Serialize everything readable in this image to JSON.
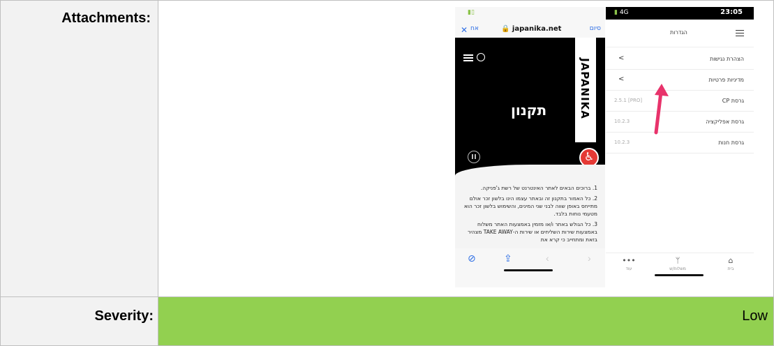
{
  "table": {
    "attachments_label": "Attachments:",
    "severity_label": "Severity:",
    "severity_value": "Low"
  },
  "colors": {
    "severity_low_bg": "#92d050",
    "label_cell_bg": "#f2f2f2",
    "border": "#bfbfbf"
  },
  "browser_shot": {
    "close": "✕",
    "back": "אח",
    "url": "🔒 japanika.net",
    "done": "סיום",
    "logo": "JAPANIKA",
    "title": "תקנון",
    "paragraphs": [
      "1. ברוכים הבאים לאתר האינטרנט של רשת ג'פניקה.",
      "2. כל האמור בתקנון זה ובאתר עצמו הינו בלשון זכר אולם מתייחס באופן שווה לבני שני המינים, והשימוש בלשון זכר הוא מטעמי נוחות בלבד.",
      "3. כל הגולש באתר ו/או מזמין באמצעות האתר משלוח באמצעות שירות השליחים או שירות ה-TAKE AWAY מצהיר בזאת ומתחייב כי קרא את"
    ],
    "icons": {
      "compass": "compass-icon",
      "share": "share-icon",
      "prev": "chevron-left-icon",
      "next": "chevron-right-icon",
      "menu": "menu-icon",
      "user": "user-icon",
      "pause": "pause-icon",
      "accessibility": "accessibility-icon"
    }
  },
  "app_shot": {
    "status": {
      "network": "4G",
      "time": "23:05"
    },
    "header_title": "הגדרות",
    "rows": [
      {
        "label": "הצהרת נגישות",
        "chevron": "<",
        "value": ""
      },
      {
        "label": "מדיניות פרטיות",
        "chevron": "<",
        "value": ""
      },
      {
        "label": "גרסת CP",
        "chevron": "",
        "value": "2.5.1 [PRO]"
      },
      {
        "label": "גרסת אפליקציה",
        "chevron": "",
        "value": "10.2.3"
      },
      {
        "label": "גרסת חנות",
        "chevron": "",
        "value": "10.2.3"
      }
    ],
    "tabs": {
      "more_icon": "•••",
      "more": "עוד",
      "orders": "משלוח/ש",
      "home": "בית"
    },
    "annotation_color": "#e8336b"
  }
}
